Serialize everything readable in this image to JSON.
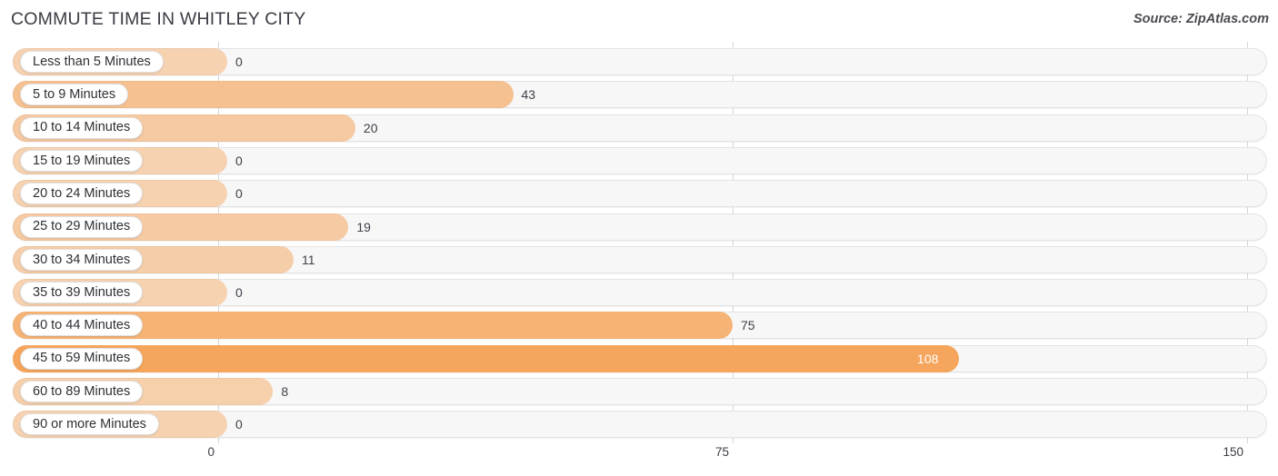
{
  "header": {
    "title": "COMMUTE TIME IN WHITLEY CITY",
    "source": "Source: ZipAtlas.com"
  },
  "chart_data": {
    "type": "bar",
    "orientation": "horizontal",
    "title": "COMMUTE TIME IN WHITLEY CITY",
    "xlabel": "",
    "ylabel": "",
    "xlim": [
      0,
      150
    ],
    "ticks": [
      "0",
      "75",
      "150"
    ],
    "tick_values": [
      0,
      75,
      150
    ],
    "grid": true,
    "legend": false,
    "categories": [
      "Less than 5 Minutes",
      "5 to 9 Minutes",
      "10 to 14 Minutes",
      "15 to 19 Minutes",
      "20 to 24 Minutes",
      "25 to 29 Minutes",
      "30 to 34 Minutes",
      "35 to 39 Minutes",
      "40 to 44 Minutes",
      "45 to 59 Minutes",
      "60 to 89 Minutes",
      "90 or more Minutes"
    ],
    "values": [
      0,
      43,
      20,
      0,
      0,
      19,
      11,
      0,
      75,
      108,
      8,
      0
    ],
    "value_labels": [
      "0",
      "43",
      "20",
      "0",
      "0",
      "19",
      "11",
      "0",
      "75",
      "108",
      "8",
      "0"
    ],
    "bar_color": "#f5a55c",
    "track_color": "#f7f7f7"
  }
}
